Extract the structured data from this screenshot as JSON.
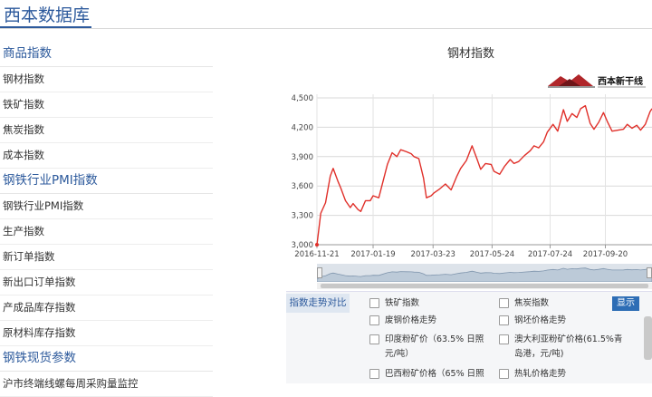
{
  "header": {
    "site_title": "西本数据库"
  },
  "sidebar": {
    "sections": [
      {
        "heading": "商品指数",
        "items": [
          "钢材指数",
          "铁矿指数",
          "焦炭指数",
          "成本指数"
        ]
      },
      {
        "heading": "钢铁行业PMI指数",
        "items": [
          "钢铁行业PMI指数",
          "生产指数",
          "新订单指数",
          "新出口订单指数",
          "产成品库存指数",
          "原材料库存指数"
        ]
      },
      {
        "heading": "钢铁现货参数",
        "items": [
          "沪市终端线螺每周采购量监控"
        ]
      }
    ]
  },
  "chart": {
    "title": "钢材指数",
    "logo_text": "西本新干线"
  },
  "chart_data": {
    "type": "line",
    "title": "钢材指数",
    "x_tick_labels": [
      "2016-11-21",
      "2017-01-19",
      "2017-03-23",
      "2017-05-24",
      "2017-07-24",
      "2017-09-20"
    ],
    "y_tick_labels": [
      "3,000",
      "3,300",
      "3,600",
      "3,900",
      "4,200",
      "4,500"
    ],
    "ylim": [
      3000,
      4500
    ],
    "grid": true,
    "series": [
      {
        "color": "#e0302a",
        "x": [
          "2016-11-21",
          "2016-11-25",
          "2016-11-30",
          "2016-12-05",
          "2016-12-08",
          "2016-12-13",
          "2016-12-16",
          "2016-12-21",
          "2016-12-26",
          "2016-12-29",
          "2017-01-03",
          "2017-01-06",
          "2017-01-11",
          "2017-01-16",
          "2017-01-19",
          "2017-01-25",
          "2017-02-03",
          "2017-02-08",
          "2017-02-13",
          "2017-02-17",
          "2017-02-23",
          "2017-02-28",
          "2017-03-03",
          "2017-03-08",
          "2017-03-13",
          "2017-03-16",
          "2017-03-21",
          "2017-03-24",
          "2017-03-30",
          "2017-04-05",
          "2017-04-11",
          "2017-04-17",
          "2017-04-21",
          "2017-04-27",
          "2017-05-03",
          "2017-05-08",
          "2017-05-12",
          "2017-05-17",
          "2017-05-23",
          "2017-05-26",
          "2017-06-01",
          "2017-06-06",
          "2017-06-12",
          "2017-06-16",
          "2017-06-21",
          "2017-06-27",
          "2017-07-03",
          "2017-07-07",
          "2017-07-12",
          "2017-07-17",
          "2017-07-21",
          "2017-07-27",
          "2017-08-01",
          "2017-08-07",
          "2017-08-11",
          "2017-08-16",
          "2017-08-21",
          "2017-08-25",
          "2017-08-30",
          "2017-09-04",
          "2017-09-08",
          "2017-09-13",
          "2017-09-18",
          "2017-09-22",
          "2017-09-27",
          "2017-10-09",
          "2017-10-13",
          "2017-10-18",
          "2017-10-23",
          "2017-10-27",
          "2017-11-01",
          "2017-11-06",
          "2017-11-08"
        ],
        "values": [
          3000,
          3320,
          3430,
          3700,
          3780,
          3650,
          3580,
          3450,
          3380,
          3420,
          3360,
          3340,
          3450,
          3450,
          3500,
          3480,
          3820,
          3940,
          3900,
          3970,
          3950,
          3930,
          3900,
          3880,
          3680,
          3480,
          3500,
          3530,
          3570,
          3620,
          3560,
          3700,
          3780,
          3860,
          4010,
          3880,
          3770,
          3830,
          3820,
          3750,
          3720,
          3800,
          3870,
          3830,
          3850,
          3910,
          3960,
          4010,
          3990,
          4050,
          4150,
          4230,
          4160,
          4380,
          4260,
          4340,
          4300,
          4390,
          4420,
          4240,
          4180,
          4250,
          4350,
          4260,
          4160,
          4180,
          4230,
          4190,
          4220,
          4170,
          4230,
          4360,
          4390
        ]
      }
    ]
  },
  "compare": {
    "tab_label": "指数走势对比",
    "show_button": "显示",
    "options": [
      {
        "label": "铁矿指数"
      },
      {
        "label": "焦炭指数"
      },
      {
        "label": "废钢价格走势"
      },
      {
        "label": "钢坯价格走势"
      },
      {
        "label": "印度粉矿价（63.5% 日照 元/吨）"
      },
      {
        "label": "澳大利亚粉矿价格(61.5%青岛港，元/吨)"
      },
      {
        "label": "巴西粉矿价格（65% 日照"
      },
      {
        "label": "热轧价格走势"
      }
    ]
  }
}
